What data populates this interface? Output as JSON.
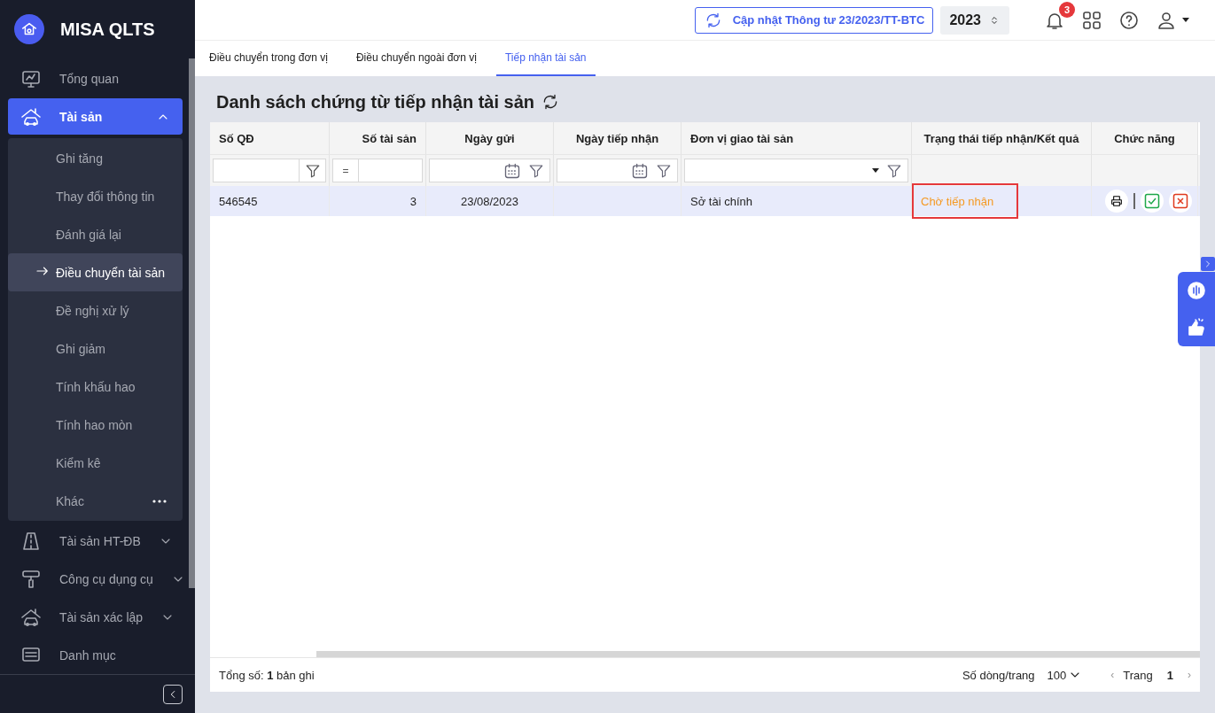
{
  "app": {
    "name": "MISA QLTS"
  },
  "sidebar": {
    "items": [
      {
        "label": "Tổng quan",
        "kind": "monitor",
        "selected": false
      },
      {
        "label": "Tài sản",
        "kind": "house-car",
        "selected": true,
        "expanded": true,
        "children": [
          {
            "label": "Ghi tăng",
            "selected": false
          },
          {
            "label": "Thay đổi thông tin",
            "selected": false
          },
          {
            "label": "Đánh giá lại",
            "selected": false
          },
          {
            "label": "Điều chuyển tài sản",
            "selected": true
          },
          {
            "label": "Đề nghị xử lý",
            "selected": false
          },
          {
            "label": "Ghi giảm",
            "selected": false
          },
          {
            "label": "Tính khấu hao",
            "selected": false
          },
          {
            "label": "Tính hao mòn",
            "selected": false
          },
          {
            "label": "Kiểm kê",
            "selected": false
          },
          {
            "label": "Khác",
            "selected": false,
            "more": true
          }
        ]
      },
      {
        "label": "Tài sản HT-ĐB",
        "kind": "road",
        "selected": false,
        "expanded": false
      },
      {
        "label": "Công cụ dụng cụ",
        "kind": "roller",
        "selected": false,
        "expanded": false
      },
      {
        "label": "Tài sản xác lập",
        "kind": "house-car",
        "selected": false,
        "expanded": false
      },
      {
        "label": "Danh mục",
        "kind": "list",
        "selected": false
      }
    ]
  },
  "header": {
    "update_button": "Cập nhật Thông tư 23/2023/TT-BTC",
    "year": "2023",
    "notification_count": "3"
  },
  "tabs": [
    {
      "label": "Điều chuyển trong đơn vị",
      "selected": false
    },
    {
      "label": "Điều chuyển ngoài đơn vị",
      "selected": false
    },
    {
      "label": "Tiếp nhận tài sản",
      "selected": true
    }
  ],
  "page_title": "Danh sách chứng từ tiếp nhận tài sản",
  "table": {
    "columns": [
      {
        "label": "Số QĐ",
        "kind": "text"
      },
      {
        "label": "Số tài sản",
        "kind": "number",
        "operator": "="
      },
      {
        "label": "Ngày gửi",
        "kind": "date"
      },
      {
        "label": "Ngày tiếp nhận",
        "kind": "date"
      },
      {
        "label": "Đơn vị giao tài sản",
        "kind": "select"
      },
      {
        "label": "Trạng thái tiếp nhận/Kết quả",
        "kind": "none"
      },
      {
        "label": "Chức năng",
        "kind": "none"
      }
    ],
    "rows": [
      {
        "selected": true,
        "cells": [
          "546545",
          "3",
          "23/08/2023",
          "",
          "Sở tài chính"
        ],
        "status": "Chờ tiếp nhận",
        "status_outlined": true
      }
    ]
  },
  "footer": {
    "total": "Tổng số: **1** bản ghi",
    "page_size_label": "Số dòng/trang",
    "page_size": "100",
    "prev": "‹",
    "page_label": "Trang",
    "page": "1",
    "next": "›"
  }
}
